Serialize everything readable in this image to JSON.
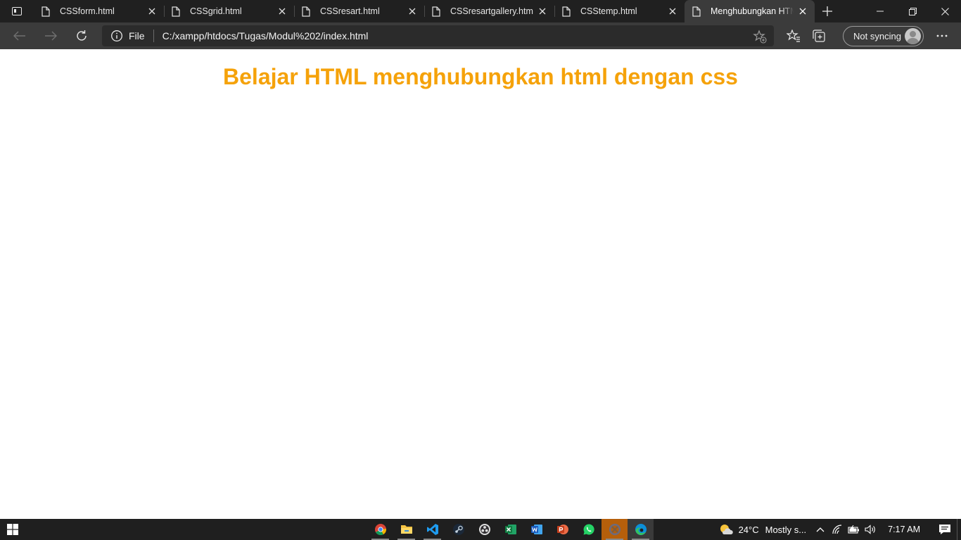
{
  "browser": {
    "tabs": [
      {
        "title": "CSSform.html",
        "active": false
      },
      {
        "title": "CSSgrid.html",
        "active": false
      },
      {
        "title": "CSSresart.html",
        "active": false
      },
      {
        "title": "CSSresartgallery.html",
        "active": false
      },
      {
        "title": "CSStemp.html",
        "active": false
      },
      {
        "title": "Menghubungkan HTML",
        "active": true
      }
    ],
    "address": {
      "scheme_label": "File",
      "url": "C:/xampp/htdocs/Tugas/Modul%202/index.html"
    },
    "sync_label": "Not syncing"
  },
  "page": {
    "heading": "Belajar HTML menghubungkan html dengan css",
    "heading_color": "#f5a20a"
  },
  "taskbar": {
    "apps": [
      {
        "name": "chrome-icon",
        "running": true
      },
      {
        "name": "file-explorer-icon",
        "running": true
      },
      {
        "name": "vscode-icon",
        "running": true
      },
      {
        "name": "steam-icon",
        "running": false
      },
      {
        "name": "obs-icon",
        "running": false
      },
      {
        "name": "excel-icon",
        "running": false
      },
      {
        "name": "word-icon",
        "running": false
      },
      {
        "name": "powerpoint-icon",
        "running": false
      },
      {
        "name": "whatsapp-icon",
        "running": false
      },
      {
        "name": "xampp-icon",
        "running": true
      },
      {
        "name": "edge-icon",
        "running": true
      }
    ],
    "weather": {
      "temp": "24°C",
      "desc": "Mostly s..."
    },
    "clock": "7:17 AM"
  }
}
